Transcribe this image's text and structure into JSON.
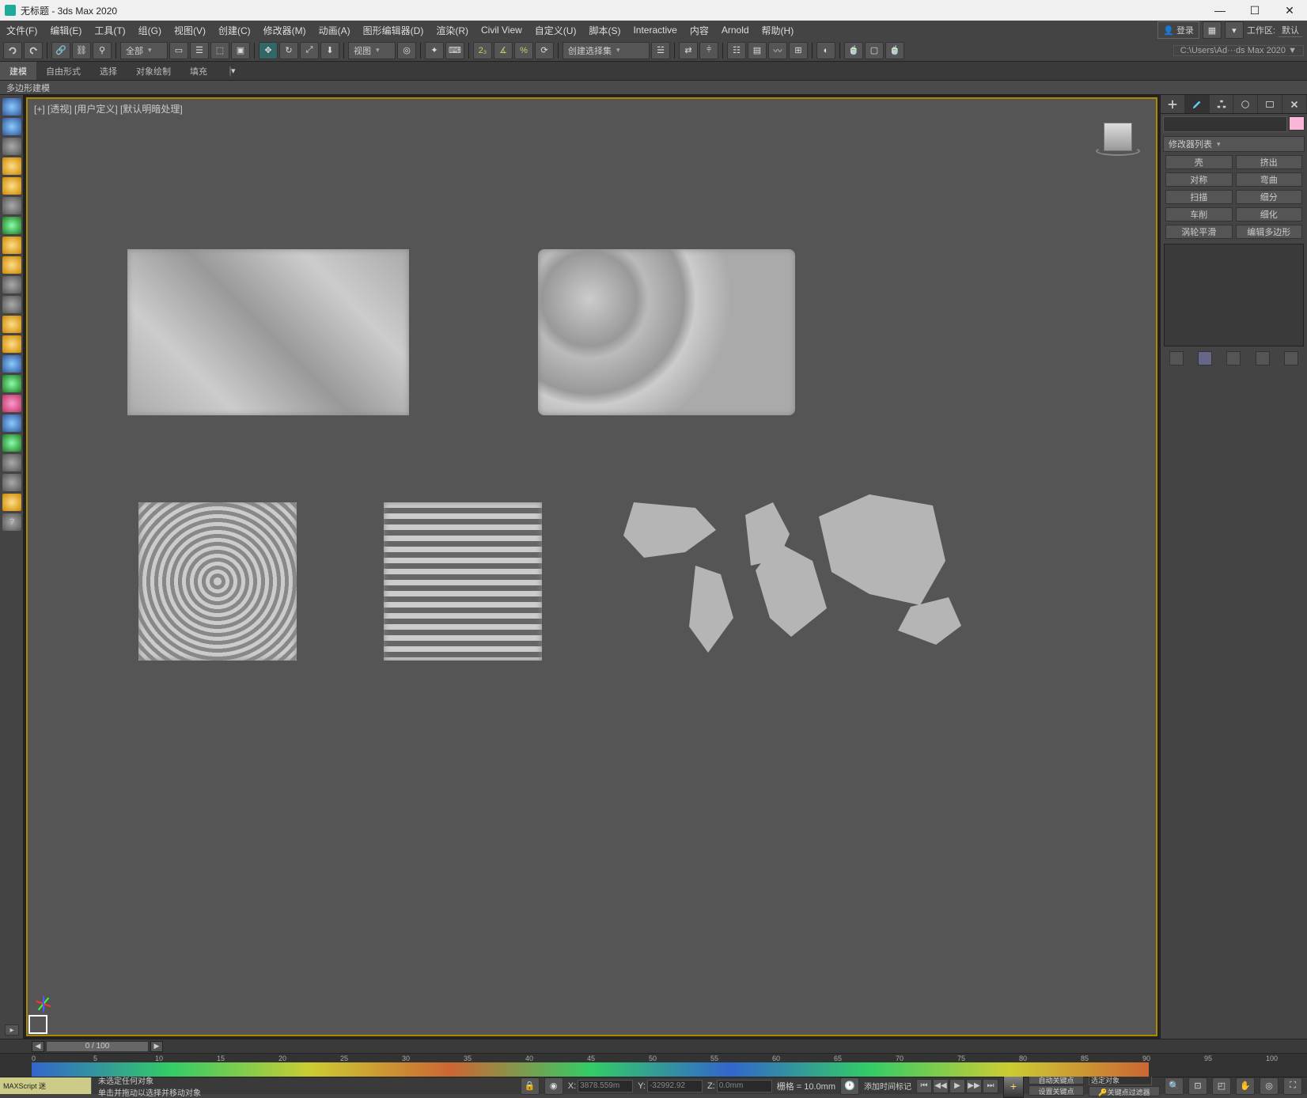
{
  "title": "无标题 - 3ds Max 2020",
  "win_controls": {
    "min": "—",
    "max": "☐",
    "close": "✕"
  },
  "menu": [
    "文件(F)",
    "编辑(E)",
    "工具(T)",
    "组(G)",
    "视图(V)",
    "创建(C)",
    "修改器(M)",
    "动画(A)",
    "图形编辑器(D)",
    "渲染(R)",
    "Civil View",
    "自定义(U)",
    "脚本(S)",
    "Interactive",
    "内容",
    "Arnold",
    "帮助(H)"
  ],
  "login": "登录",
  "workspace_label": "工作区:",
  "workspace_value": "默认",
  "path_display": "C:\\Users\\Ad···ds Max 2020 ▼",
  "toolbar": {
    "filter_all": "全部",
    "view_dd": "视图",
    "sel_set": "创建选择集"
  },
  "ribbon": [
    "建模",
    "自由形式",
    "选择",
    "对象绘制",
    "填充"
  ],
  "ribbon_sub": "多边形建模",
  "viewport": {
    "label": "[+] [透视] [用户定义] [默认明暗处理]"
  },
  "cmd_panel": {
    "modlist": "修改器列表",
    "btns": [
      [
        "壳",
        "挤出"
      ],
      [
        "对称",
        "弯曲"
      ],
      [
        "扫描",
        "细分"
      ],
      [
        "车削",
        "细化"
      ],
      [
        "涡轮平滑",
        "编辑多边形"
      ]
    ]
  },
  "timeline": {
    "pos": "0 / 100"
  },
  "timetrack_ticks": [
    "0",
    "5",
    "10",
    "15",
    "20",
    "25",
    "30",
    "35",
    "40",
    "45",
    "50",
    "55",
    "60",
    "65",
    "70",
    "75",
    "80",
    "85",
    "90",
    "95",
    "100"
  ],
  "status": {
    "maxscript": "MAXScript 迷",
    "msg1": "未选定任何对象",
    "msg2": "单击并拖动以选择并移动对象",
    "add_marker": "添加时间标记",
    "x_label": "X:",
    "x_val": "3878.559m",
    "y_label": "Y:",
    "y_val": "-32992.92",
    "z_label": "Z:",
    "z_val": "0.0mm",
    "grid_label": "栅格 = 10.0mm",
    "auto_key": "自动关键点",
    "set_key": "设置关键点",
    "sel_obj": "选定对象",
    "key_filter": "关键点过滤器"
  }
}
